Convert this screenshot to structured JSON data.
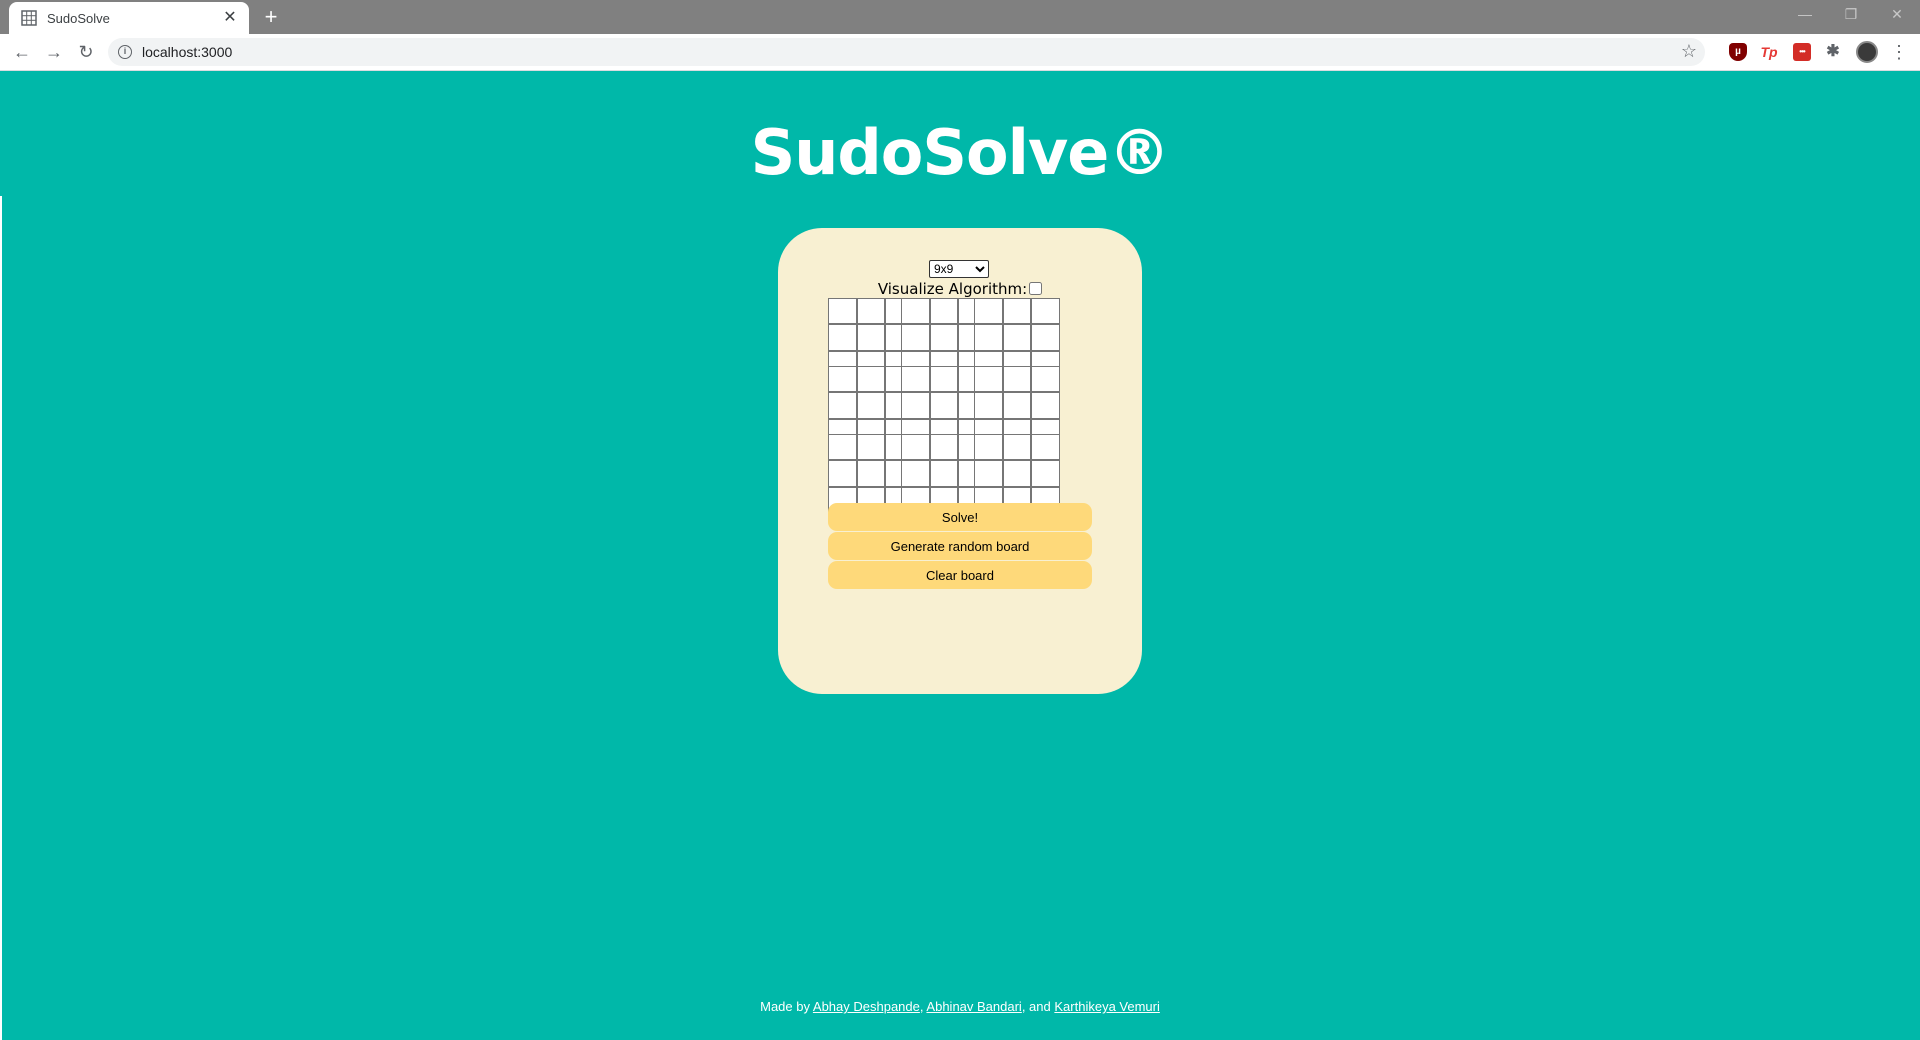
{
  "browser": {
    "tab_title": "SudoSolve",
    "tab_close": "✕",
    "new_tab": "+",
    "url": "localhost:3000",
    "window_controls": [
      "—",
      "❐",
      "✕"
    ],
    "extensions": [
      "ublock-origin",
      "tp",
      "lastpass",
      "puzzle"
    ],
    "ext_tp_label": "Tp",
    "ext_lastpass_label": "•••"
  },
  "app": {
    "title": "SudoSolve®",
    "board_size_options": [
      "9x9"
    ],
    "board_size_selected": "9x9",
    "visualize_label": "Visualize Algorithm:",
    "visualize_checked": false,
    "board": {
      "rows": 9,
      "cols": 9,
      "values": [
        [
          "",
          "",
          "",
          "",
          "",
          "",
          "",
          "",
          ""
        ],
        [
          "",
          "",
          "",
          "",
          "",
          "",
          "",
          "",
          ""
        ],
        [
          "",
          "",
          "",
          "",
          "",
          "",
          "",
          "",
          ""
        ],
        [
          "",
          "",
          "",
          "",
          "",
          "",
          "",
          "",
          ""
        ],
        [
          "",
          "",
          "",
          "",
          "",
          "",
          "",
          "",
          ""
        ],
        [
          "",
          "",
          "",
          "",
          "",
          "",
          "",
          "",
          ""
        ],
        [
          "",
          "",
          "",
          "",
          "",
          "",
          "",
          "",
          ""
        ],
        [
          "",
          "",
          "",
          "",
          "",
          "",
          "",
          "",
          ""
        ],
        [
          "",
          "",
          "",
          "",
          "",
          "",
          "",
          "",
          ""
        ]
      ]
    },
    "buttons": {
      "solve": "Solve!",
      "generate": "Generate random board",
      "clear": "Clear board"
    }
  },
  "footer": {
    "prefix": "Made by",
    "author1": "Abhay Deshpande",
    "sep1": ",",
    "author2": "Abhinav Bandari",
    "sep2": ", and",
    "author3": "Karthikeya Vemuri"
  },
  "colors": {
    "page_bg": "#00b8a9",
    "card_bg": "#f8f0d2",
    "button_bg": "#fed97a",
    "chrome_tabbar": "#808080"
  }
}
